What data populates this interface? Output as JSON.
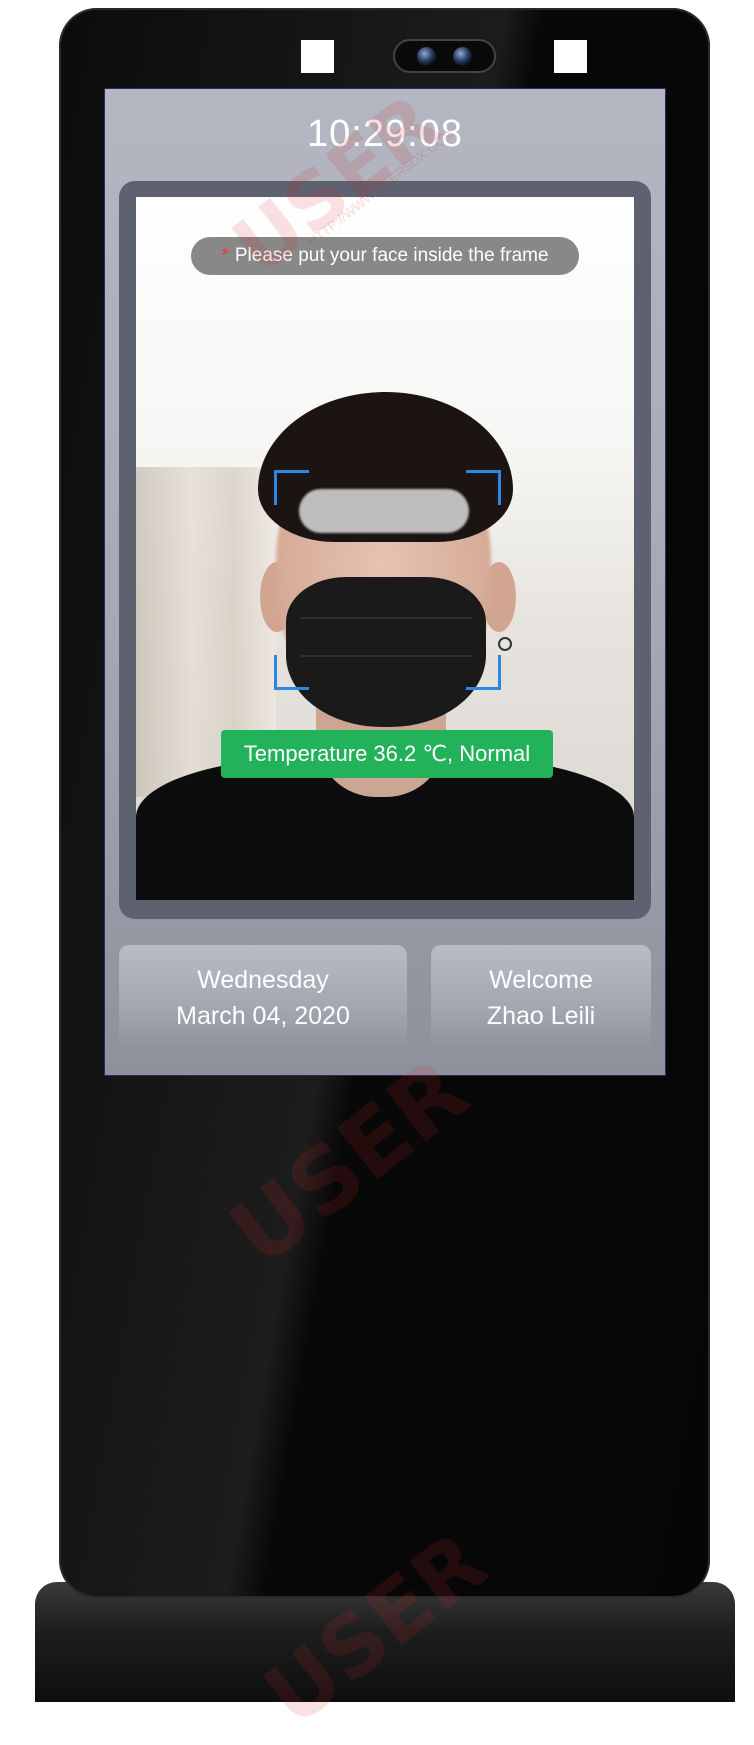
{
  "clock": {
    "time": "10:29:08"
  },
  "camera": {
    "prompt_star": "*",
    "prompt_text": "Please put your face inside the frame",
    "temperature_text": "Temperature 36.2 ℃, Normal",
    "status_color": "#22b25a",
    "bracket_color": "#2b88e0"
  },
  "date_card": {
    "weekday": "Wednesday",
    "date": "March 04, 2020"
  },
  "welcome_card": {
    "greeting": "Welcome",
    "name": "Zhao Leili"
  },
  "watermark": {
    "brand": "USER",
    "url": "HTTP://WWW.USERSDX.COM"
  }
}
